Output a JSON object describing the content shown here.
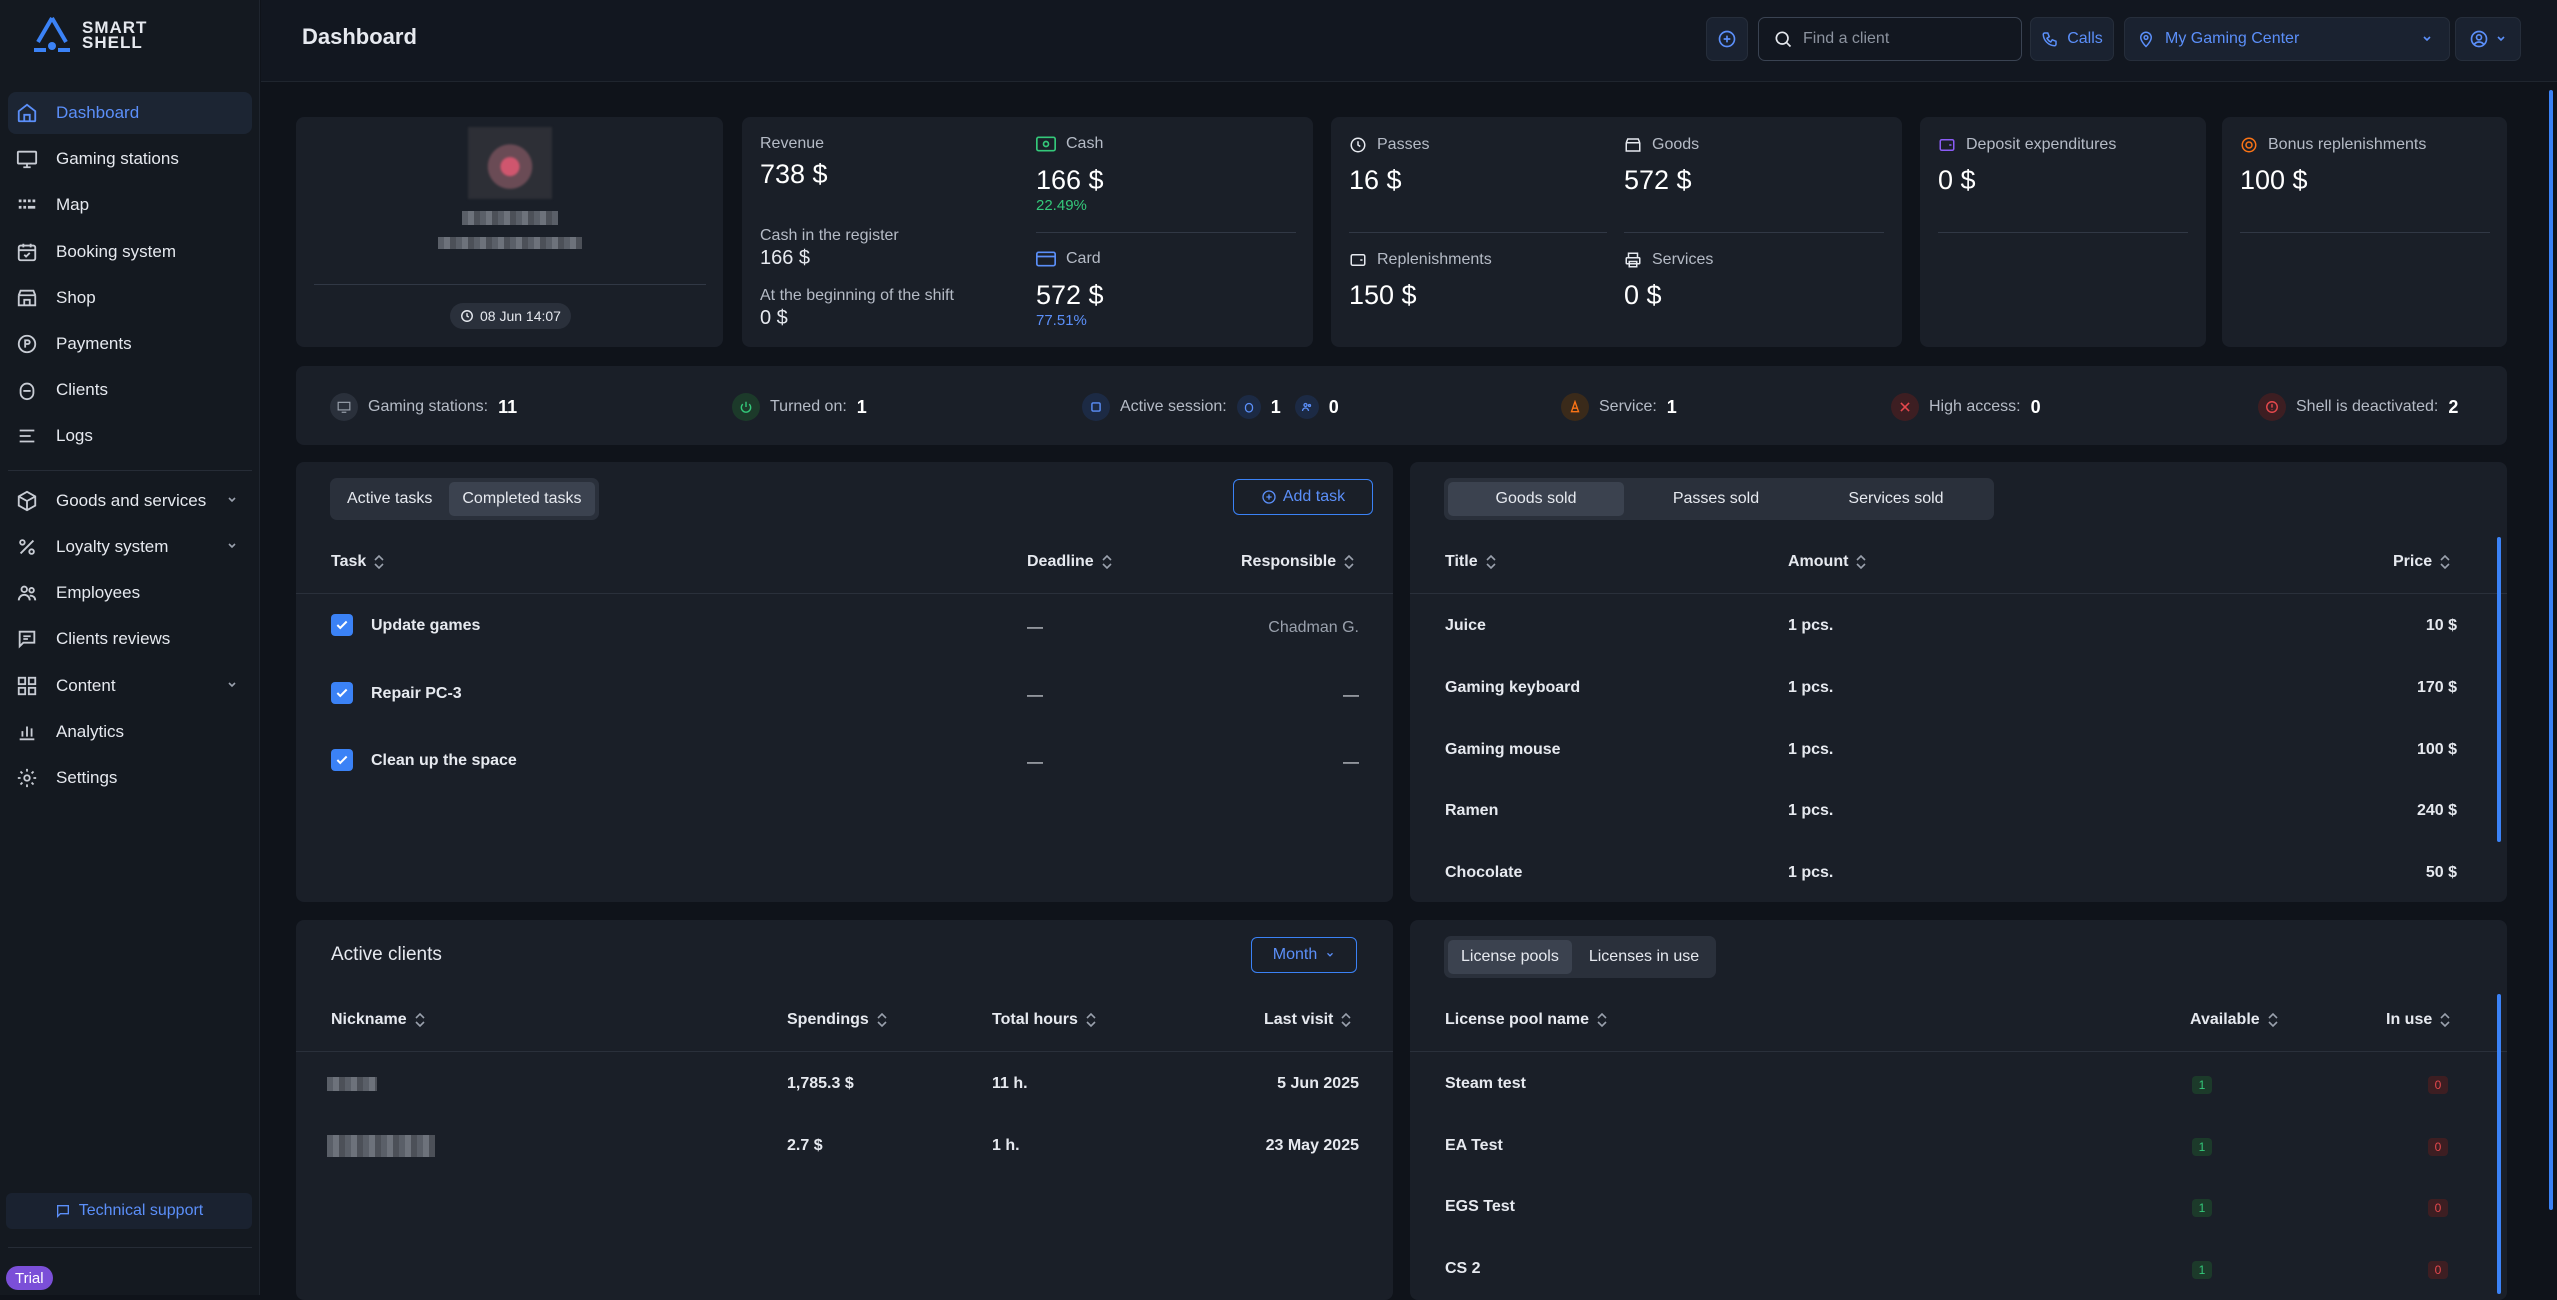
{
  "app": {
    "logo_line1": "SMART",
    "logo_line2": "SHELL"
  },
  "sidebar": {
    "items": [
      {
        "label": "Dashboard"
      },
      {
        "label": "Gaming stations"
      },
      {
        "label": "Map"
      },
      {
        "label": "Booking system"
      },
      {
        "label": "Shop"
      },
      {
        "label": "Payments"
      },
      {
        "label": "Clients"
      },
      {
        "label": "Logs"
      },
      {
        "label": "Goods and services"
      },
      {
        "label": "Loyalty system"
      },
      {
        "label": "Employees"
      },
      {
        "label": "Clients reviews"
      },
      {
        "label": "Content"
      },
      {
        "label": "Analytics"
      },
      {
        "label": "Settings"
      }
    ],
    "tech_support": "Technical support",
    "trial": "Trial"
  },
  "header": {
    "title": "Dashboard",
    "search_placeholder": "Find a client",
    "calls": "Calls",
    "location": "My Gaming Center"
  },
  "shift": {
    "time": "08 Jun 14:07"
  },
  "revenue": {
    "revenue_label": "Revenue",
    "revenue_value": "738 $",
    "register_label": "Cash in the register",
    "register_value": "166 $",
    "begin_label": "At the beginning of the shift",
    "begin_value": "0 $",
    "cash_label": "Cash",
    "cash_value": "166 $",
    "cash_pct": "22.49%",
    "card_label": "Card",
    "card_value": "572 $",
    "card_pct": "77.51%"
  },
  "sales": {
    "passes_label": "Passes",
    "passes_value": "16 $",
    "goods_label": "Goods",
    "goods_value": "572 $",
    "repl_label": "Replenishments",
    "repl_value": "150 $",
    "services_label": "Services",
    "services_value": "0 $"
  },
  "deposit": {
    "label": "Deposit expenditures",
    "value": "0 $"
  },
  "bonus": {
    "label": "Bonus replenishments",
    "value": "100 $"
  },
  "status": {
    "stations_label": "Gaming stations:",
    "stations_value": "11",
    "on_label": "Turned on:",
    "on_value": "1",
    "session_label": "Active session:",
    "session_guest": "1",
    "session_client": "0",
    "service_label": "Service:",
    "service_value": "1",
    "high_label": "High access:",
    "high_value": "0",
    "shell_label": "Shell is deactivated:",
    "shell_value": "2"
  },
  "tasks": {
    "tab_active": "Active tasks",
    "tab_completed": "Completed tasks",
    "add": "Add task",
    "col_task": "Task",
    "col_deadline": "Deadline",
    "col_responsible": "Responsible",
    "rows": [
      {
        "task": "Update games",
        "deadline": "—",
        "responsible": "Chadman G."
      },
      {
        "task": "Repair PC-3",
        "deadline": "—",
        "responsible": "—"
      },
      {
        "task": "Clean up the space",
        "deadline": "—",
        "responsible": "—"
      }
    ]
  },
  "sold": {
    "tab_goods": "Goods sold",
    "tab_passes": "Passes sold",
    "tab_services": "Services sold",
    "col_title": "Title",
    "col_amount": "Amount",
    "col_price": "Price",
    "rows": [
      {
        "title": "Juice",
        "amount": "1 pcs.",
        "price": "10 $"
      },
      {
        "title": "Gaming keyboard",
        "amount": "1 pcs.",
        "price": "170 $"
      },
      {
        "title": "Gaming mouse",
        "amount": "1 pcs.",
        "price": "100 $"
      },
      {
        "title": "Ramen",
        "amount": "1 pcs.",
        "price": "240 $"
      },
      {
        "title": "Chocolate",
        "amount": "1 pcs.",
        "price": "50 $"
      }
    ]
  },
  "clients": {
    "title": "Active clients",
    "period": "Month",
    "col_nick": "Nickname",
    "col_spend": "Spendings",
    "col_hours": "Total hours",
    "col_visit": "Last visit",
    "rows": [
      {
        "spend": "1,785.3 $",
        "hours": "11 h.",
        "visit": "5 Jun 2025"
      },
      {
        "spend": "2.7 $",
        "hours": "1 h.",
        "visit": "23 May 2025"
      }
    ]
  },
  "licenses": {
    "tab_pools": "License pools",
    "tab_use": "Licenses in use",
    "col_name": "License pool name",
    "col_avail": "Available",
    "col_inuse": "In use",
    "rows": [
      {
        "name": "Steam test",
        "avail": "1",
        "inuse": "0"
      },
      {
        "name": "EA Test",
        "avail": "1",
        "inuse": "0"
      },
      {
        "name": "EGS Test",
        "avail": "1",
        "inuse": "0"
      },
      {
        "name": "CS 2",
        "avail": "1",
        "inuse": "0"
      }
    ]
  },
  "colors": {
    "accent": "#5b8ff9",
    "positive": "#34c87a",
    "negative": "#e5484d",
    "trial": "#7b4fd8"
  }
}
